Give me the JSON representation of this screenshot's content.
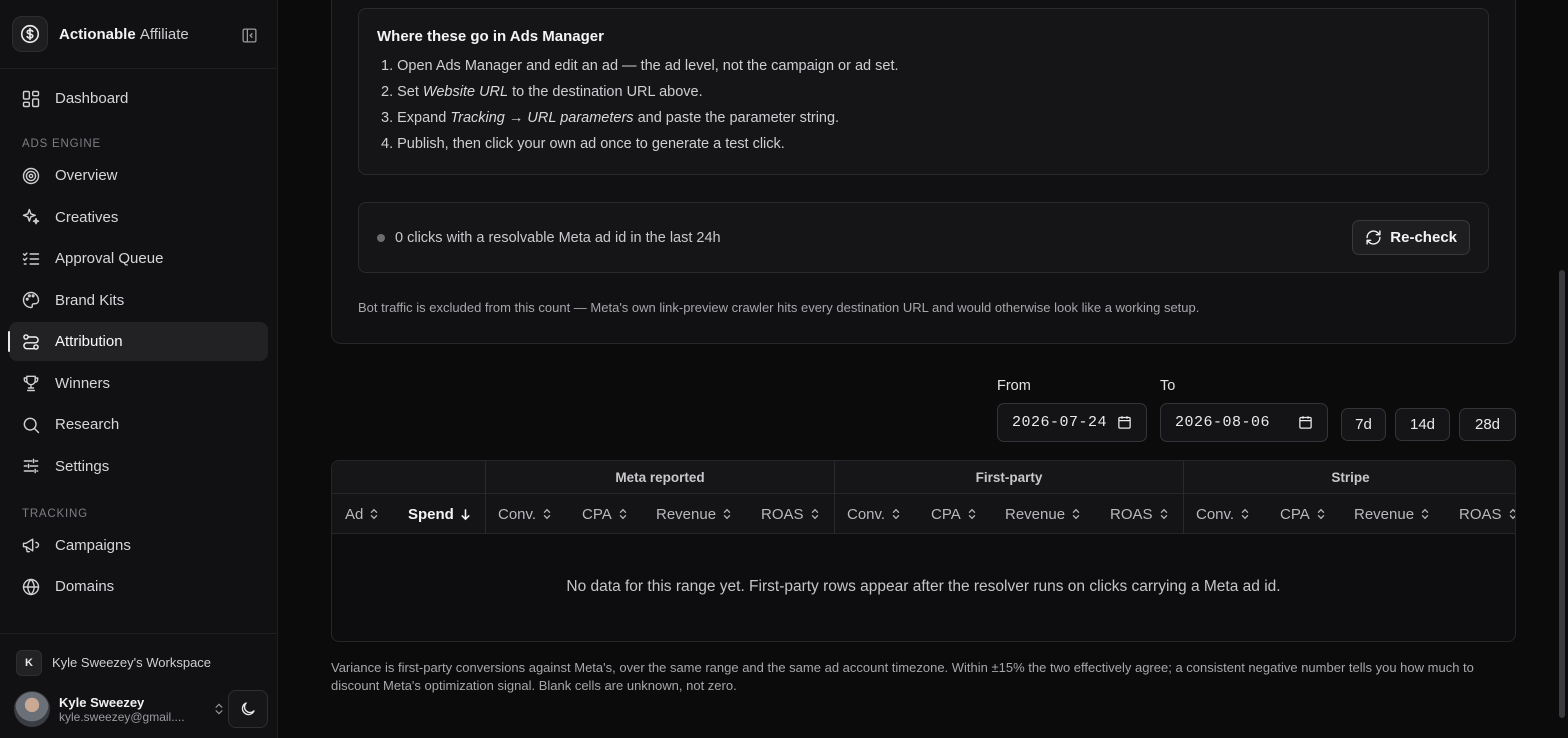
{
  "brand": {
    "name_bold": "Actionable",
    "name_light": "Affiliate",
    "logo_icon": "dollar-icon"
  },
  "sidebar": {
    "top_items": [
      {
        "label": "Dashboard",
        "icon": "dashboard-icon"
      }
    ],
    "sections": [
      {
        "title": "ADS ENGINE",
        "items": [
          {
            "label": "Overview",
            "icon": "target-icon"
          },
          {
            "label": "Creatives",
            "icon": "sparkles-icon"
          },
          {
            "label": "Approval Queue",
            "icon": "list-check-icon"
          },
          {
            "label": "Brand Kits",
            "icon": "palette-icon"
          },
          {
            "label": "Attribution",
            "icon": "route-icon",
            "active": true
          },
          {
            "label": "Winners",
            "icon": "trophy-icon"
          },
          {
            "label": "Research",
            "icon": "search-icon"
          },
          {
            "label": "Settings",
            "icon": "sliders-icon"
          }
        ]
      },
      {
        "title": "TRACKING",
        "items": [
          {
            "label": "Campaigns",
            "icon": "megaphone-icon"
          },
          {
            "label": "Domains",
            "icon": "globe-icon"
          }
        ]
      }
    ]
  },
  "workspace": {
    "badge": "K",
    "name": "Kyle Sweezey's Workspace"
  },
  "user": {
    "name": "Kyle Sweezey",
    "email": "kyle.sweezey@gmail...."
  },
  "howto": {
    "title": "Where these go in Ads Manager",
    "steps": [
      {
        "n": "1.",
        "parts": [
          {
            "t": "Open Ads Manager and edit an ad — the ad level, not the campaign or ad set."
          }
        ]
      },
      {
        "n": "2.",
        "parts": [
          {
            "t": "Set "
          },
          {
            "t": "Website URL",
            "em": true
          },
          {
            "t": " to the destination URL above."
          }
        ]
      },
      {
        "n": "3.",
        "parts": [
          {
            "t": "Expand "
          },
          {
            "t": "Tracking → URL parameters",
            "em": true
          },
          {
            "t": " and paste the parameter string."
          }
        ]
      },
      {
        "n": "4.",
        "parts": [
          {
            "t": "Publish, then click your own ad once to generate a test click."
          }
        ]
      }
    ]
  },
  "status": {
    "text": "0 clicks with a resolvable Meta ad id in the last 24h",
    "recheck_label": "Re-check"
  },
  "bot_note": "Bot traffic is excluded from this count — Meta's own link-preview crawler hits every destination URL and would otherwise look like a working setup.",
  "range": {
    "from_label": "From",
    "from_value": "2026-07-24",
    "to_label": "To",
    "to_value": "2026-08-06",
    "presets": [
      "7d",
      "14d",
      "28d"
    ]
  },
  "table": {
    "groups": [
      "Meta reported",
      "First-party",
      "Stripe"
    ],
    "ad_col": "Ad",
    "spend_col": "Spend",
    "group_cols": [
      "Conv.",
      "CPA",
      "Revenue",
      "ROAS"
    ],
    "empty_text": "No data for this range yet. First-party rows appear after the resolver runs on clicks carrying a Meta ad id."
  },
  "variance_note": "Variance is first-party conversions against Meta's, over the same range and the same ad account timezone. Within ±15% the two effectively agree; a consistent negative number tells you how much to discount Meta's optimization signal. Blank cells are unknown, not zero."
}
